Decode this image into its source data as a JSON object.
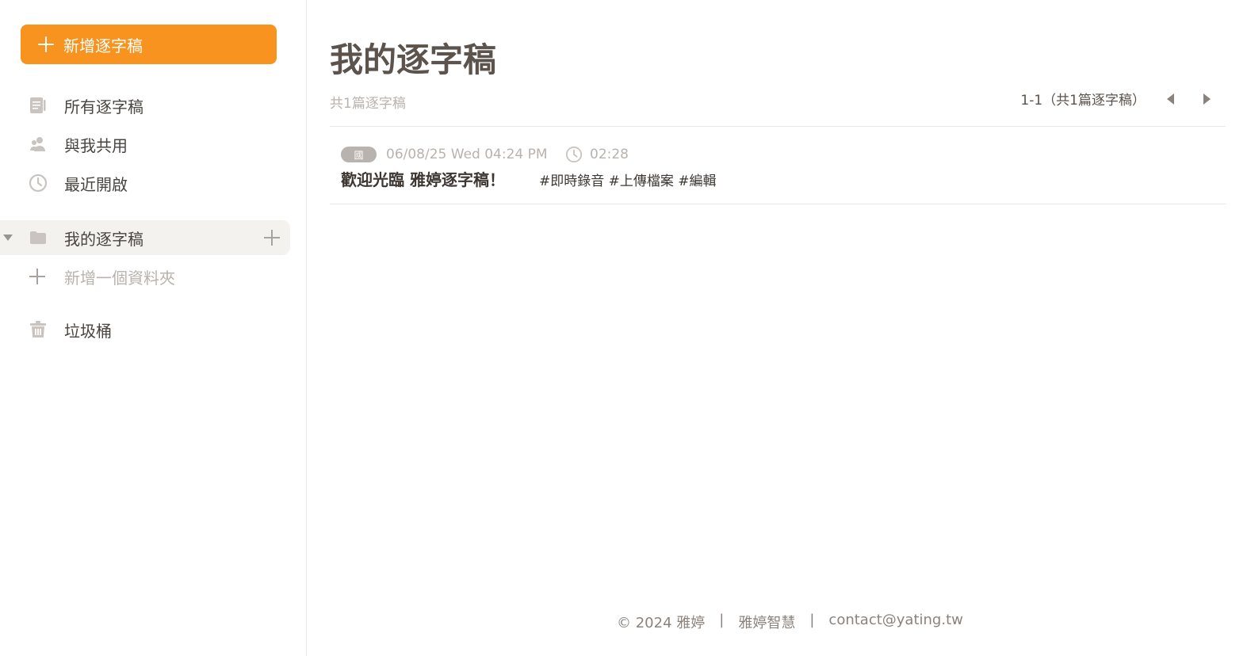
{
  "sidebar": {
    "new_button_label": "新增逐字稿",
    "nav": [
      {
        "label": "所有逐字稿",
        "icon": "document-icon"
      },
      {
        "label": "與我共用",
        "icon": "people-icon"
      },
      {
        "label": "最近開啟",
        "icon": "clock-icon"
      }
    ],
    "folder": {
      "label": "我的逐字稿",
      "icon": "folder-icon"
    },
    "add_folder_label": "新增一個資料夾",
    "trash_label": "垃圾桶"
  },
  "main": {
    "title": "我的逐字稿",
    "count_text": "共1篇逐字稿",
    "pager_text": "1-1（共1篇逐字稿）",
    "items": [
      {
        "badge": "國",
        "date": "06/08/25 Wed 04:24 PM",
        "duration": "02:28",
        "title": "歡迎光臨 雅婷逐字稿！",
        "tags": "#即時錄音 #上傳檔案 #編輯"
      }
    ]
  },
  "footer": {
    "copyright": "© 2024 雅婷",
    "sep1": "|",
    "company": "雅婷智慧",
    "sep2": "|",
    "email": "contact@yating.tw"
  },
  "colors": {
    "accent": "#f7931e",
    "text": "#4a4440",
    "muted": "#b8b3ae",
    "active_bg": "#f4f2ef"
  }
}
